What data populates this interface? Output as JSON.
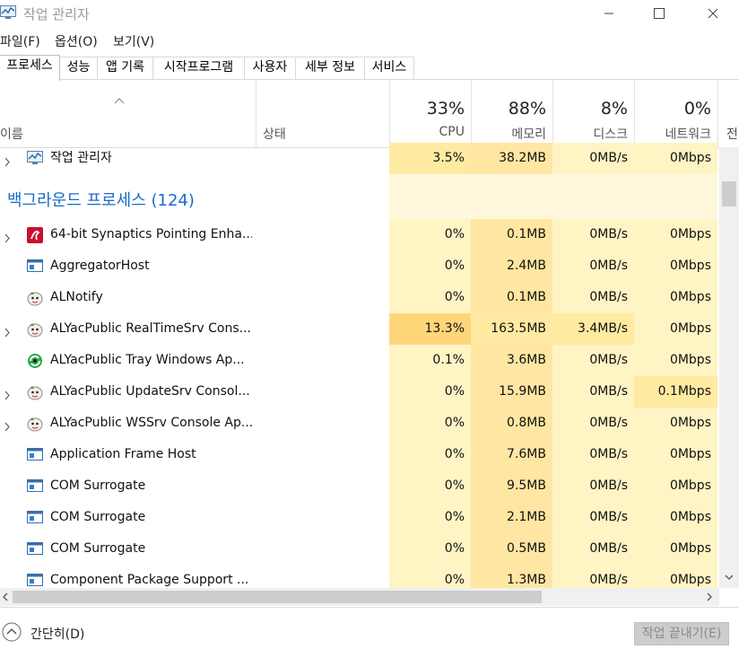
{
  "window": {
    "title": "작업 관리자"
  },
  "menu": [
    "파일(F)",
    "옵션(O)",
    "보기(V)"
  ],
  "tabs": [
    "프로세스",
    "성능",
    "앱 기록",
    "시작프로그램",
    "사용자",
    "세부 정보",
    "서비스"
  ],
  "active_tab": "프로세스",
  "columns": {
    "name": "이름",
    "status": "상태",
    "cpu": {
      "pct": "33%",
      "label": "CPU"
    },
    "memory": {
      "pct": "88%",
      "label": "메모리"
    },
    "disk": {
      "pct": "8%",
      "label": "디스크"
    },
    "network": {
      "pct": "0%",
      "label": "네트워크"
    },
    "power": "전"
  },
  "apps": [
    {
      "name": "작업 관리자",
      "icon": "task-manager-icon",
      "cpu": "3.5%",
      "memory": "38.2MB",
      "disk": "0MB/s",
      "network": "0Mbps",
      "expandable": true
    }
  ],
  "background_group": "백그라운드 프로세스 (124)",
  "processes": [
    {
      "name": "64-bit Synaptics Pointing Enha...",
      "icon": "synaptics-icon",
      "cpu": "0%",
      "memory": "0.1MB",
      "disk": "0MB/s",
      "network": "0Mbps",
      "expandable": true
    },
    {
      "name": "AggregatorHost",
      "icon": "window-app-icon",
      "cpu": "0%",
      "memory": "2.4MB",
      "disk": "0MB/s",
      "network": "0Mbps",
      "expandable": false
    },
    {
      "name": "ALNotify",
      "icon": "alyac-icon",
      "cpu": "0%",
      "memory": "0.1MB",
      "disk": "0MB/s",
      "network": "0Mbps",
      "expandable": false
    },
    {
      "name": "ALYacPublic RealTimeSrv Cons...",
      "icon": "alyac-icon",
      "cpu": "13.3%",
      "memory": "163.5MB",
      "disk": "3.4MB/s",
      "network": "0Mbps",
      "expandable": true
    },
    {
      "name": "ALYacPublic Tray Windows Ap...",
      "icon": "alyac-tray-icon",
      "cpu": "0.1%",
      "memory": "3.6MB",
      "disk": "0MB/s",
      "network": "0Mbps",
      "expandable": false
    },
    {
      "name": "ALYacPublic UpdateSrv Consol...",
      "icon": "alyac-icon",
      "cpu": "0%",
      "memory": "15.9MB",
      "disk": "0MB/s",
      "network": "0.1Mbps",
      "expandable": true
    },
    {
      "name": "ALYacPublic WSSrv Console Ap...",
      "icon": "alyac-icon",
      "cpu": "0%",
      "memory": "0.8MB",
      "disk": "0MB/s",
      "network": "0Mbps",
      "expandable": true
    },
    {
      "name": "Application Frame Host",
      "icon": "window-app-icon",
      "cpu": "0%",
      "memory": "7.6MB",
      "disk": "0MB/s",
      "network": "0Mbps",
      "expandable": false
    },
    {
      "name": "COM Surrogate",
      "icon": "window-app-icon",
      "cpu": "0%",
      "memory": "9.5MB",
      "disk": "0MB/s",
      "network": "0Mbps",
      "expandable": false
    },
    {
      "name": "COM Surrogate",
      "icon": "window-app-icon",
      "cpu": "0%",
      "memory": "2.1MB",
      "disk": "0MB/s",
      "network": "0Mbps",
      "expandable": false
    },
    {
      "name": "COM Surrogate",
      "icon": "window-app-icon",
      "cpu": "0%",
      "memory": "0.5MB",
      "disk": "0MB/s",
      "network": "0Mbps",
      "expandable": false
    },
    {
      "name": "Component Package Support ...",
      "icon": "window-app-icon",
      "cpu": "0%",
      "memory": "1.3MB",
      "disk": "0MB/s",
      "network": "0Mbps",
      "expandable": false
    }
  ],
  "footer": {
    "collapse": "간단히(D)",
    "end_task": "작업 끝내기(E)"
  },
  "colors": {
    "heat_low": "#fff4c4",
    "heat_mid": "#ffeaa2",
    "heat_high": "#ffd67a",
    "memory_col": "#ffe6a3",
    "group_title": "#1b6ac9"
  }
}
